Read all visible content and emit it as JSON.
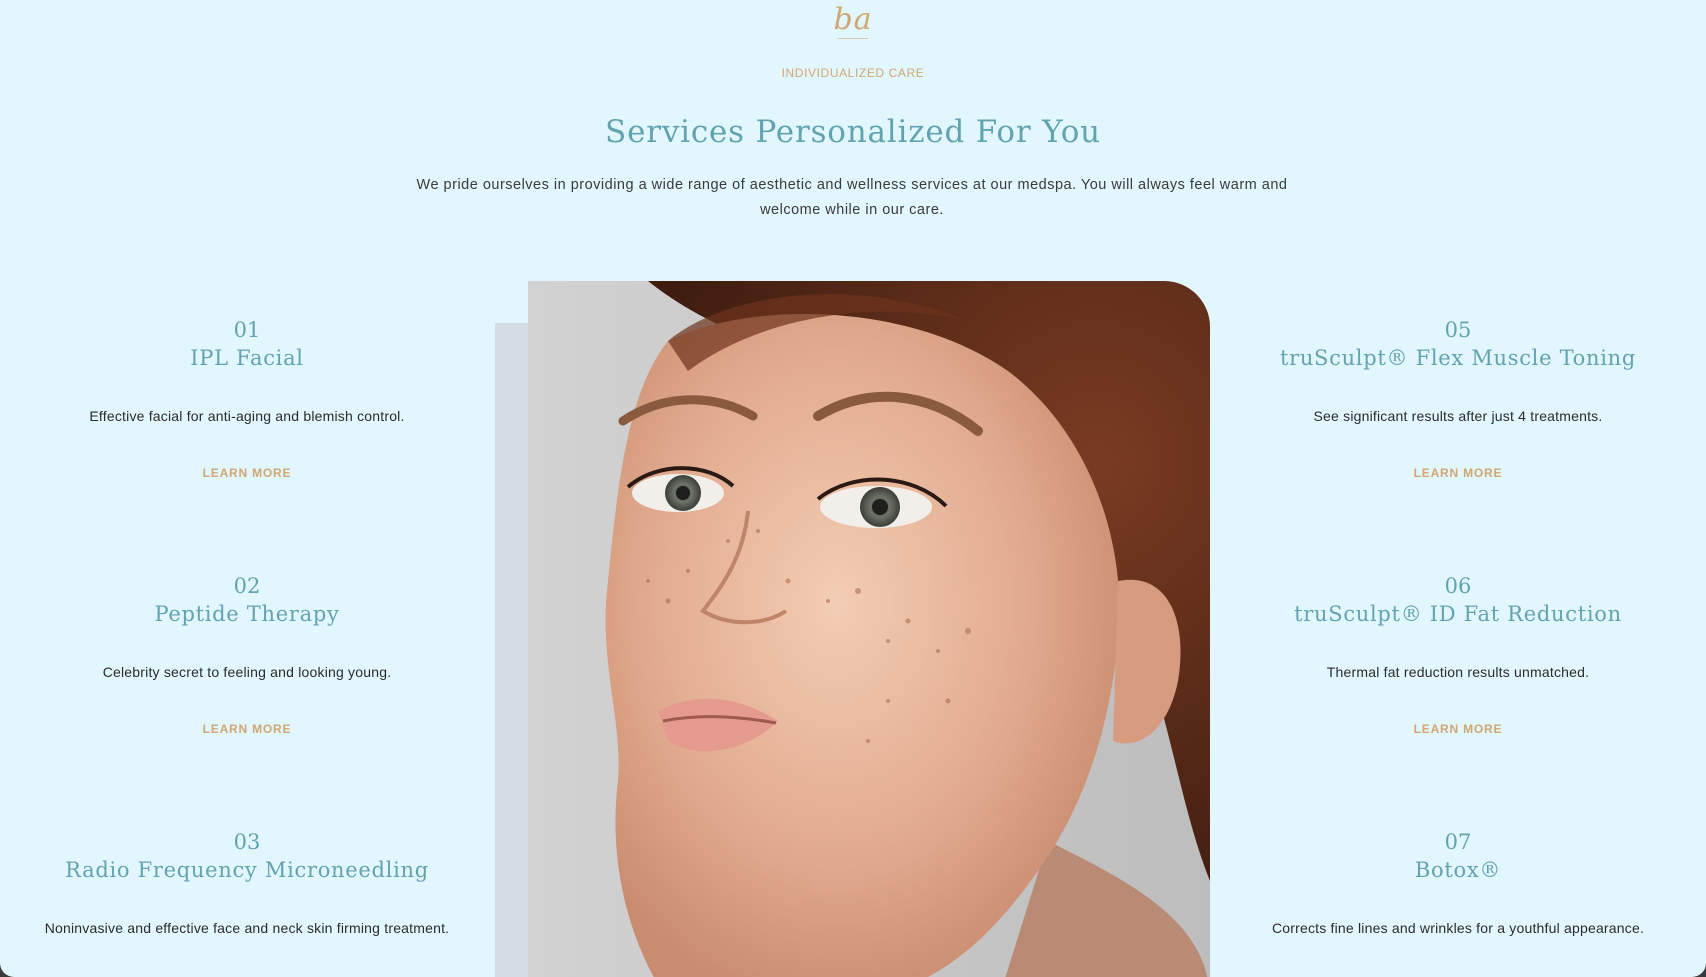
{
  "brand": {
    "logo_text": "ba"
  },
  "hero": {
    "eyebrow": "INDIVIDUALIZED CARE",
    "title": "Services Personalized For You",
    "description": "We pride ourselves in providing a wide range of aesthetic and wellness services at our medspa. You will always feel warm and welcome while in our care."
  },
  "services_left": [
    {
      "number": "01",
      "title": "IPL Facial",
      "description": "Effective facial for anti-aging and blemish control.",
      "link": "LEARN MORE"
    },
    {
      "number": "02",
      "title": "Peptide Therapy",
      "description": "Celebrity secret to feeling and looking young.",
      "link": "LEARN MORE"
    },
    {
      "number": "03",
      "title": "Radio Frequency Microneedling",
      "description": "Noninvasive and effective face and neck skin firming treatment."
    }
  ],
  "services_right": [
    {
      "number": "05",
      "title": "truSculpt® Flex Muscle Toning",
      "description": "See significant results after just 4 treatments.",
      "link": "LEARN MORE"
    },
    {
      "number": "06",
      "title": "truSculpt® ID Fat Reduction",
      "description": "Thermal fat reduction results unmatched.",
      "link": "LEARN MORE"
    },
    {
      "number": "07",
      "title": "Botox®",
      "description": "Corrects fine lines and wrinkles for a youthful appearance."
    }
  ],
  "colors": {
    "background": "#e2f6fd",
    "accent_gold": "#d0a772",
    "heading_teal": "#62a3b0",
    "body_text": "#2b2b2b"
  }
}
